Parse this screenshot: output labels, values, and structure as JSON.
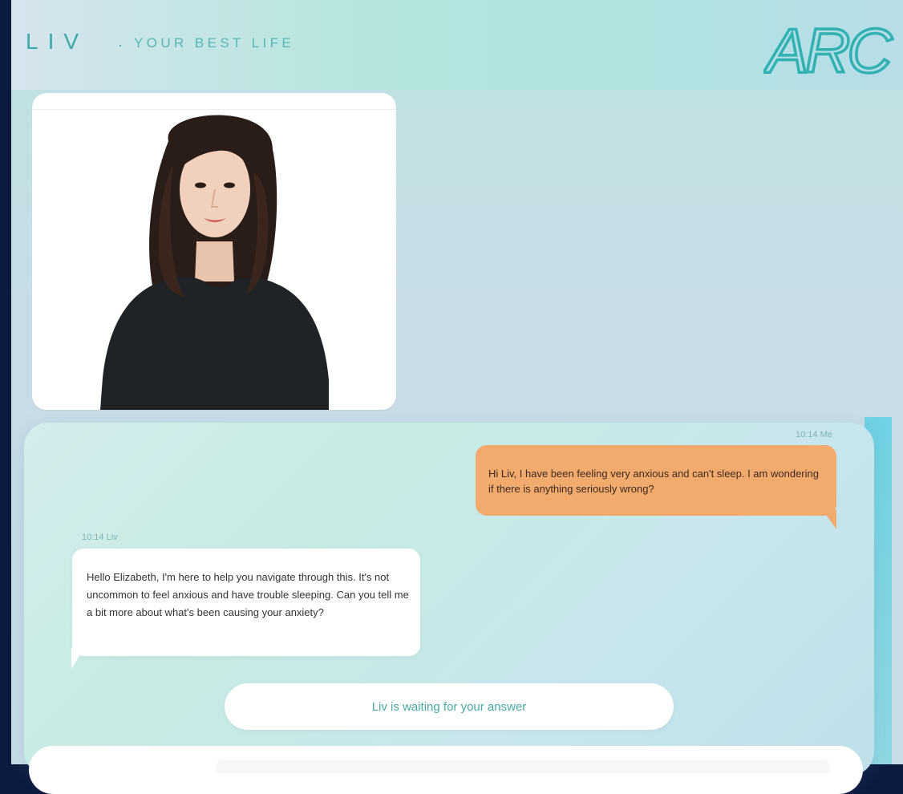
{
  "header": {
    "brand": "LIV",
    "separator": "·",
    "tagline": "YOUR BEST LIFE",
    "logo_text": "ARC"
  },
  "colors": {
    "accent": "#3ea9a6",
    "user_bubble": "#f2aa6d",
    "bot_bubble": "#ffffff",
    "logo_dot": "#f2c14a"
  },
  "video": {
    "avatar_icon": "avatar-portrait"
  },
  "chat": {
    "messages": [
      {
        "sender": "Me",
        "time": "10:14 Me",
        "text": "Hi Liv, I have been feeling very anxious and can't sleep. I am wondering if there is anything seriously wrong?"
      },
      {
        "sender": "Liv",
        "time": "10:14 Liv",
        "text": "Hello Elizabeth, I'm here to help you navigate through this. It's not uncommon to feel anxious and have trouble sleeping. Can you tell me a bit more about what's been causing your anxiety?"
      }
    ],
    "status": "Liv is waiting for your answer"
  }
}
